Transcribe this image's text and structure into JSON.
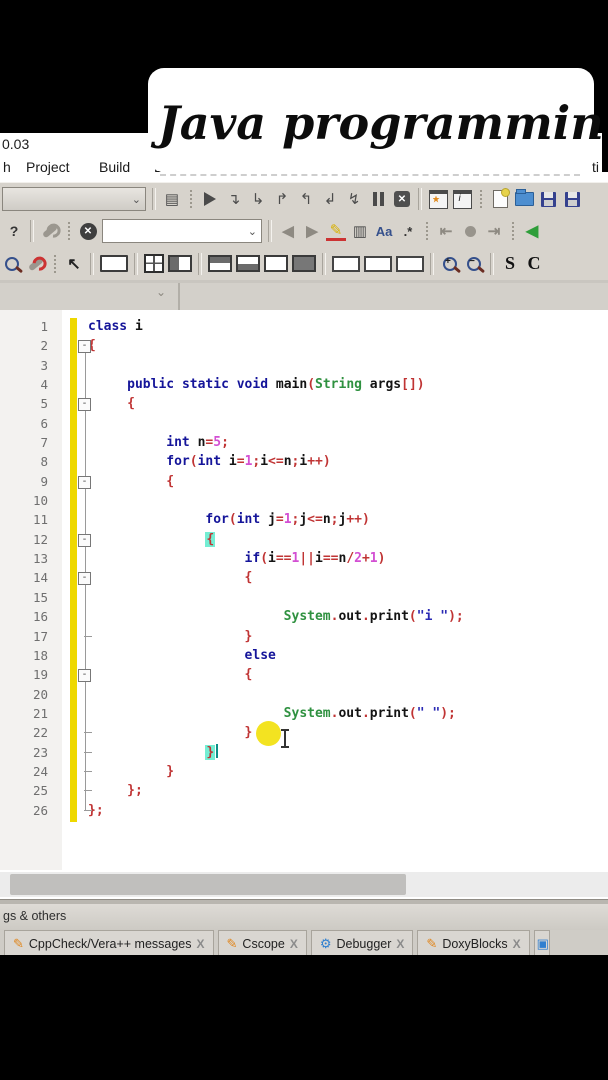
{
  "overlay": {
    "title": "Java programming"
  },
  "window": {
    "title_fragment": "0.03",
    "menu_items": {
      "m0": "h",
      "m1": "Project",
      "m2": "Build",
      "m3": "De",
      "right_fragment": "ti"
    }
  },
  "toolbar": {
    "help_label": "?",
    "match_case_label": "Aa",
    "regex_label": ".*",
    "s_label": "S",
    "c_label": "C",
    "fold_minus": "-"
  },
  "editor": {
    "click_highlight_line": 16,
    "lines": [
      {
        "n": 1,
        "indent": 0,
        "fold": null,
        "tokens": [
          [
            "k",
            "class"
          ],
          [
            "pl",
            " i"
          ]
        ]
      },
      {
        "n": 2,
        "indent": 0,
        "fold": "box",
        "tokens": [
          [
            "op",
            "{"
          ]
        ]
      },
      {
        "n": 3,
        "indent": 0,
        "fold": null,
        "tokens": []
      },
      {
        "n": 4,
        "indent": 5,
        "fold": null,
        "tokens": [
          [
            "k",
            "public"
          ],
          [
            "pl",
            " "
          ],
          [
            "k",
            "static"
          ],
          [
            "pl",
            " "
          ],
          [
            "k",
            "void"
          ],
          [
            "pl",
            " main"
          ],
          [
            "op",
            "("
          ],
          [
            "cls",
            "String"
          ],
          [
            "pl",
            " args"
          ],
          [
            "op",
            "[])"
          ]
        ]
      },
      {
        "n": 5,
        "indent": 5,
        "fold": "box",
        "tokens": [
          [
            "op",
            "{"
          ]
        ]
      },
      {
        "n": 6,
        "indent": 0,
        "fold": null,
        "tokens": []
      },
      {
        "n": 7,
        "indent": 10,
        "fold": null,
        "tokens": [
          [
            "k",
            "int"
          ],
          [
            "pl",
            " n"
          ],
          [
            "op",
            "="
          ],
          [
            "num",
            "5"
          ],
          [
            "op",
            ";"
          ]
        ]
      },
      {
        "n": 8,
        "indent": 10,
        "fold": null,
        "tokens": [
          [
            "k",
            "for"
          ],
          [
            "op",
            "("
          ],
          [
            "k",
            "int"
          ],
          [
            "pl",
            " i"
          ],
          [
            "op",
            "="
          ],
          [
            "num",
            "1"
          ],
          [
            "op",
            ";"
          ],
          [
            "pl",
            "i"
          ],
          [
            "op",
            "<="
          ],
          [
            "pl",
            "n"
          ],
          [
            "op",
            ";"
          ],
          [
            "pl",
            "i"
          ],
          [
            "op",
            "++)"
          ]
        ]
      },
      {
        "n": 9,
        "indent": 10,
        "fold": "box",
        "tokens": [
          [
            "op",
            "{"
          ]
        ]
      },
      {
        "n": 10,
        "indent": 0,
        "fold": null,
        "tokens": []
      },
      {
        "n": 11,
        "indent": 15,
        "fold": null,
        "tokens": [
          [
            "k",
            "for"
          ],
          [
            "op",
            "("
          ],
          [
            "k",
            "int"
          ],
          [
            "pl",
            " j"
          ],
          [
            "op",
            "="
          ],
          [
            "num",
            "1"
          ],
          [
            "op",
            ";"
          ],
          [
            "pl",
            "j"
          ],
          [
            "op",
            "<="
          ],
          [
            "pl",
            "n"
          ],
          [
            "op",
            ";"
          ],
          [
            "pl",
            "j"
          ],
          [
            "op",
            "++)"
          ]
        ]
      },
      {
        "n": 12,
        "indent": 15,
        "fold": "box",
        "tokens": [
          [
            "brm",
            "{"
          ]
        ]
      },
      {
        "n": 13,
        "indent": 20,
        "fold": null,
        "tokens": [
          [
            "k",
            "if"
          ],
          [
            "op",
            "("
          ],
          [
            "pl",
            "i"
          ],
          [
            "op",
            "=="
          ],
          [
            "num",
            "1"
          ],
          [
            "op",
            "||"
          ],
          [
            "pl",
            "i"
          ],
          [
            "op",
            "=="
          ],
          [
            "pl",
            "n"
          ],
          [
            "op",
            "/"
          ],
          [
            "num",
            "2"
          ],
          [
            "op",
            "+"
          ],
          [
            "num",
            "1"
          ],
          [
            "op",
            ")"
          ]
        ]
      },
      {
        "n": 14,
        "indent": 20,
        "fold": "box",
        "tokens": [
          [
            "op",
            "{"
          ]
        ]
      },
      {
        "n": 15,
        "indent": 0,
        "fold": null,
        "tokens": []
      },
      {
        "n": 16,
        "indent": 25,
        "fold": null,
        "tokens": [
          [
            "cls",
            "System"
          ],
          [
            "op",
            "."
          ],
          [
            "pl",
            "out"
          ],
          [
            "op",
            "."
          ],
          [
            "pl",
            "print"
          ],
          [
            "op",
            "("
          ],
          [
            "str",
            "\"i \""
          ],
          [
            "op",
            ");"
          ]
        ]
      },
      {
        "n": 17,
        "indent": 20,
        "fold": "tick",
        "tokens": [
          [
            "op",
            "}"
          ]
        ]
      },
      {
        "n": 18,
        "indent": 20,
        "fold": null,
        "tokens": [
          [
            "k",
            "else"
          ]
        ]
      },
      {
        "n": 19,
        "indent": 20,
        "fold": "box",
        "tokens": [
          [
            "op",
            "{"
          ]
        ]
      },
      {
        "n": 20,
        "indent": 0,
        "fold": null,
        "tokens": []
      },
      {
        "n": 21,
        "indent": 25,
        "fold": null,
        "tokens": [
          [
            "cls",
            "System"
          ],
          [
            "op",
            "."
          ],
          [
            "pl",
            "out"
          ],
          [
            "op",
            "."
          ],
          [
            "pl",
            "print"
          ],
          [
            "op",
            "("
          ],
          [
            "str",
            "\" \""
          ],
          [
            "op",
            ");"
          ]
        ]
      },
      {
        "n": 22,
        "indent": 20,
        "fold": "tick",
        "tokens": [
          [
            "op",
            "}"
          ]
        ]
      },
      {
        "n": 23,
        "indent": 15,
        "fold": "tick",
        "tokens": [
          [
            "brm",
            "}"
          ],
          [
            "caret",
            ""
          ]
        ]
      },
      {
        "n": 24,
        "indent": 10,
        "fold": "tick",
        "tokens": [
          [
            "op",
            "}"
          ]
        ]
      },
      {
        "n": 25,
        "indent": 5,
        "fold": "tick",
        "tokens": [
          [
            "op",
            "};"
          ]
        ]
      },
      {
        "n": 26,
        "indent": 0,
        "fold": "corner",
        "tokens": [
          [
            "op",
            "};"
          ]
        ]
      }
    ]
  },
  "logs_panel": {
    "title": "gs & others",
    "close_label": "X",
    "tabs": [
      {
        "icon": "pencil",
        "label": "CppCheck/Vera++ messages"
      },
      {
        "icon": "pencil",
        "label": "Cscope"
      },
      {
        "icon": "gear",
        "label": "Debugger"
      },
      {
        "icon": "pencil",
        "label": "DoxyBlocks"
      }
    ]
  },
  "colors": {
    "keyword": "#15159a",
    "class_green": "#2f9140",
    "number_magenta": "#d34fd3",
    "operator_red": "#c03434",
    "string_blue": "#2a2ab4",
    "brace_match_bg": "#74eed3",
    "change_bar_yellow": "#eed800",
    "click_highlight": "#f2e215",
    "toolbar_bg": "#d7d3cc"
  }
}
